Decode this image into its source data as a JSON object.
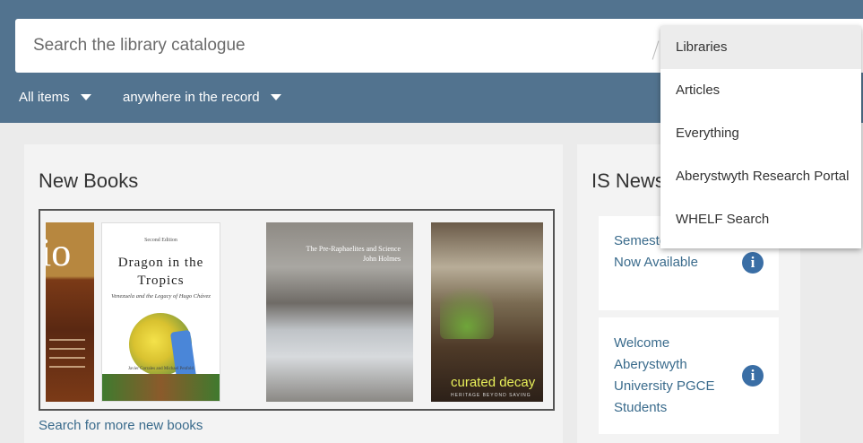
{
  "search": {
    "placeholder": "Search the library catalogue"
  },
  "filters": {
    "items_label": "All items",
    "scope_label": "anywhere in the record"
  },
  "new_books": {
    "title": "New Books",
    "more_link": "Search for more new books",
    "covers": [
      {
        "text": "io"
      },
      {
        "edition": "Second Edition",
        "title": "Dragon in the Tropics",
        "subtitle": "Venezuela and the Legacy of Hugo Chávez",
        "authors": "Javier Corrales and Michael Penfold"
      },
      {
        "title": "The Pre-Raphaelites and Science",
        "author": "John Holmes"
      },
      {
        "title": "curated decay",
        "subtitle": "HERITAGE BEYOND SAVING"
      }
    ]
  },
  "news": {
    "title": "IS News",
    "items": [
      {
        "text": "Semester Timetable Now Available"
      },
      {
        "text": "Welcome Aberystwyth University PGCE Students"
      }
    ]
  },
  "dropdown": {
    "items": [
      {
        "label": "Libraries"
      },
      {
        "label": "Articles"
      },
      {
        "label": "Everything"
      },
      {
        "label": "Aberystwyth Research Portal"
      },
      {
        "label": "WHELF Search"
      }
    ]
  },
  "colors": {
    "header": "#52738f",
    "link": "#3a6b8c",
    "info": "#3a6ea5"
  }
}
